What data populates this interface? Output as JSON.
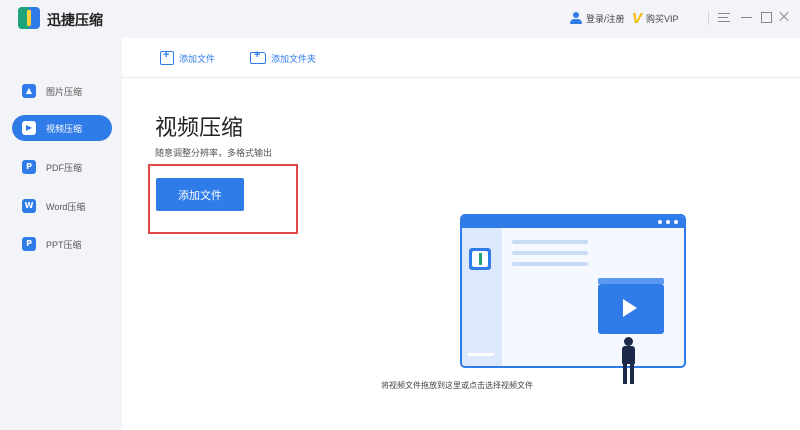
{
  "app": {
    "title": "迅捷压缩"
  },
  "titlebar": {
    "login_label": "登录/注册",
    "vip_label": "购买VIP"
  },
  "sidebar": {
    "items": [
      {
        "label": "图片压缩",
        "icon": "image-icon",
        "color": "#2f7be8",
        "active": false
      },
      {
        "label": "视频压缩",
        "icon": "video-icon",
        "color": "#2f7be8",
        "active": true
      },
      {
        "label": "PDF压缩",
        "icon": "pdf-icon",
        "color": "#2f7be8",
        "active": false
      },
      {
        "label": "Word压缩",
        "icon": "word-icon",
        "color": "#2f7be8",
        "active": false
      },
      {
        "label": "PPT压缩",
        "icon": "ppt-icon",
        "color": "#2f7be8",
        "active": false
      }
    ]
  },
  "toolbar": {
    "add_file_label": "添加文件",
    "add_folder_label": "添加文件夹"
  },
  "main": {
    "title": "视频压缩",
    "subtitle": "随意调整分辨率，多格式输出",
    "add_button_label": "添加文件",
    "drop_hint": "将视频文件拖放到这里或点击选择视频文件"
  },
  "colors": {
    "accent": "#2f7be8",
    "highlight": "#e04848",
    "vip": "#f6b800"
  }
}
